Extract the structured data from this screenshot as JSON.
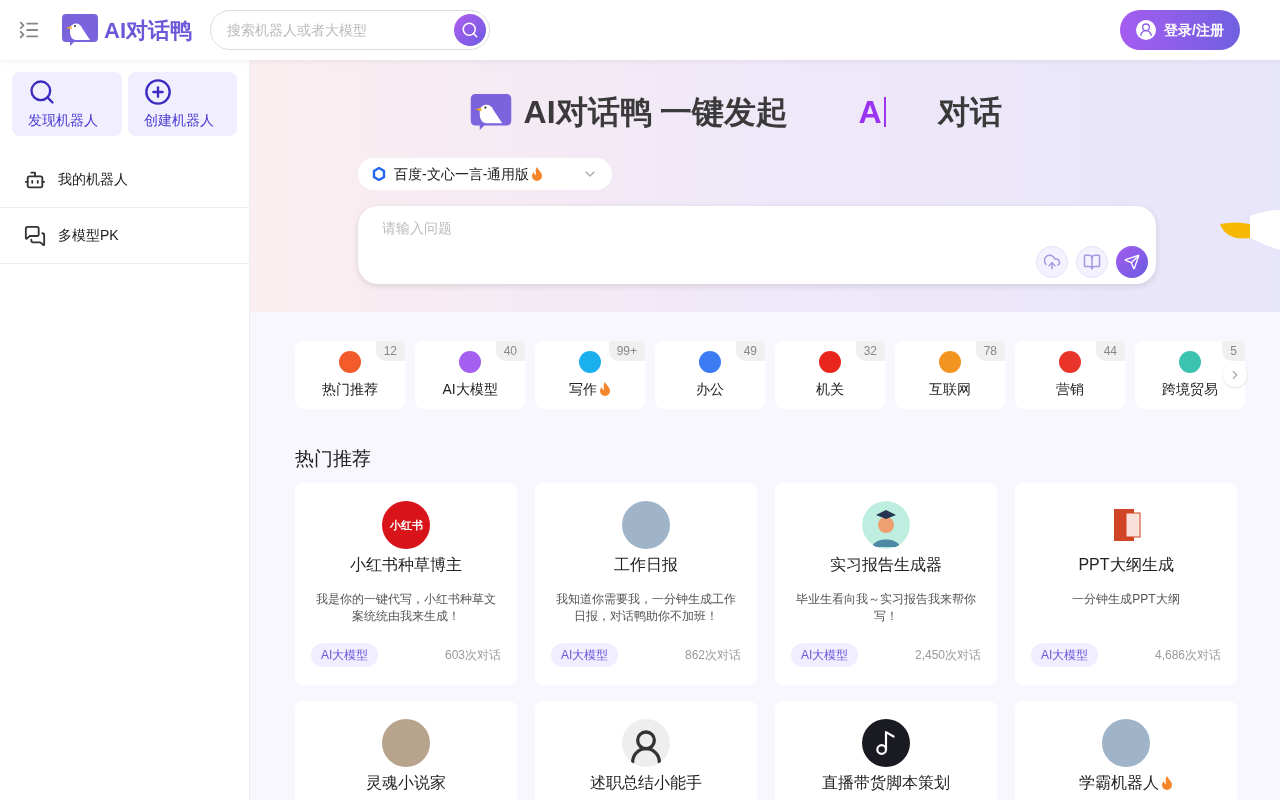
{
  "header": {
    "brand": "AI对话鸭",
    "search": {
      "placeholder": "搜索机器人或者大模型"
    },
    "login": "登录/注册"
  },
  "sidebar": {
    "actions": [
      {
        "kind": "discover",
        "label": "发现机器人"
      },
      {
        "kind": "create",
        "label": "创建机器人"
      }
    ],
    "items": [
      {
        "kind": "robot",
        "label": "我的机器人"
      },
      {
        "kind": "chat",
        "label": "多模型PK"
      }
    ]
  },
  "hero": {
    "title": "AI对话鸭 一键发起",
    "typing": "A",
    "suffix": "对话",
    "model": {
      "label": "百度-文心一言-通用版",
      "hot": true
    },
    "input": {
      "placeholder": "请输入问题"
    }
  },
  "categories": [
    {
      "label": "热门推荐",
      "count": "12",
      "color": "#f45b2a",
      "hot": false
    },
    {
      "label": "AI大模型",
      "count": "40",
      "color": "#a55ff0",
      "hot": false
    },
    {
      "label": "写作",
      "count": "99+",
      "color": "#1ab0f0",
      "hot": true
    },
    {
      "label": "办公",
      "count": "49",
      "color": "#3b7cf5",
      "hot": false
    },
    {
      "label": "机关",
      "count": "32",
      "color": "#e8261c",
      "hot": false
    },
    {
      "label": "互联网",
      "count": "78",
      "color": "#f39320",
      "hot": false
    },
    {
      "label": "营销",
      "count": "44",
      "color": "#e8342a",
      "hot": false
    },
    {
      "label": "跨境贸易",
      "count": "5",
      "color": "#3cc2b0",
      "hot": false
    }
  ],
  "section_title": "热门推荐",
  "cards": [
    {
      "kind": "logo",
      "avatar_text": "小红书",
      "title": "小红书种草博主",
      "hot": false,
      "desc": "我是你的一键代写，小红书种草文案统统由我来生成！",
      "tag": "AI大模型",
      "uses": "603次对话"
    },
    {
      "kind": "photo",
      "title": "工作日报",
      "hot": false,
      "desc": "我知道你需要我，一分钟生成工作日报，对话鸭助你不加班！",
      "tag": "AI大模型",
      "uses": "862次对话"
    },
    {
      "kind": "student",
      "title": "实习报告生成器",
      "hot": false,
      "desc": "毕业生看向我～实习报告我来帮你写！",
      "tag": "AI大模型",
      "uses": "2,450次对话"
    },
    {
      "kind": "slides",
      "title": "PPT大纲生成",
      "hot": false,
      "desc": "一分钟生成PPT大纲",
      "tag": "AI大模型",
      "uses": "4,686次对话"
    },
    {
      "kind": "photo",
      "title": "灵魂小说家",
      "hot": false
    },
    {
      "kind": "person",
      "title": "述职总结小能手",
      "hot": false
    },
    {
      "kind": "note",
      "title": "直播带货脚本策划",
      "hot": false
    },
    {
      "kind": "photo",
      "title": "学霸机器人",
      "hot": true
    }
  ]
}
